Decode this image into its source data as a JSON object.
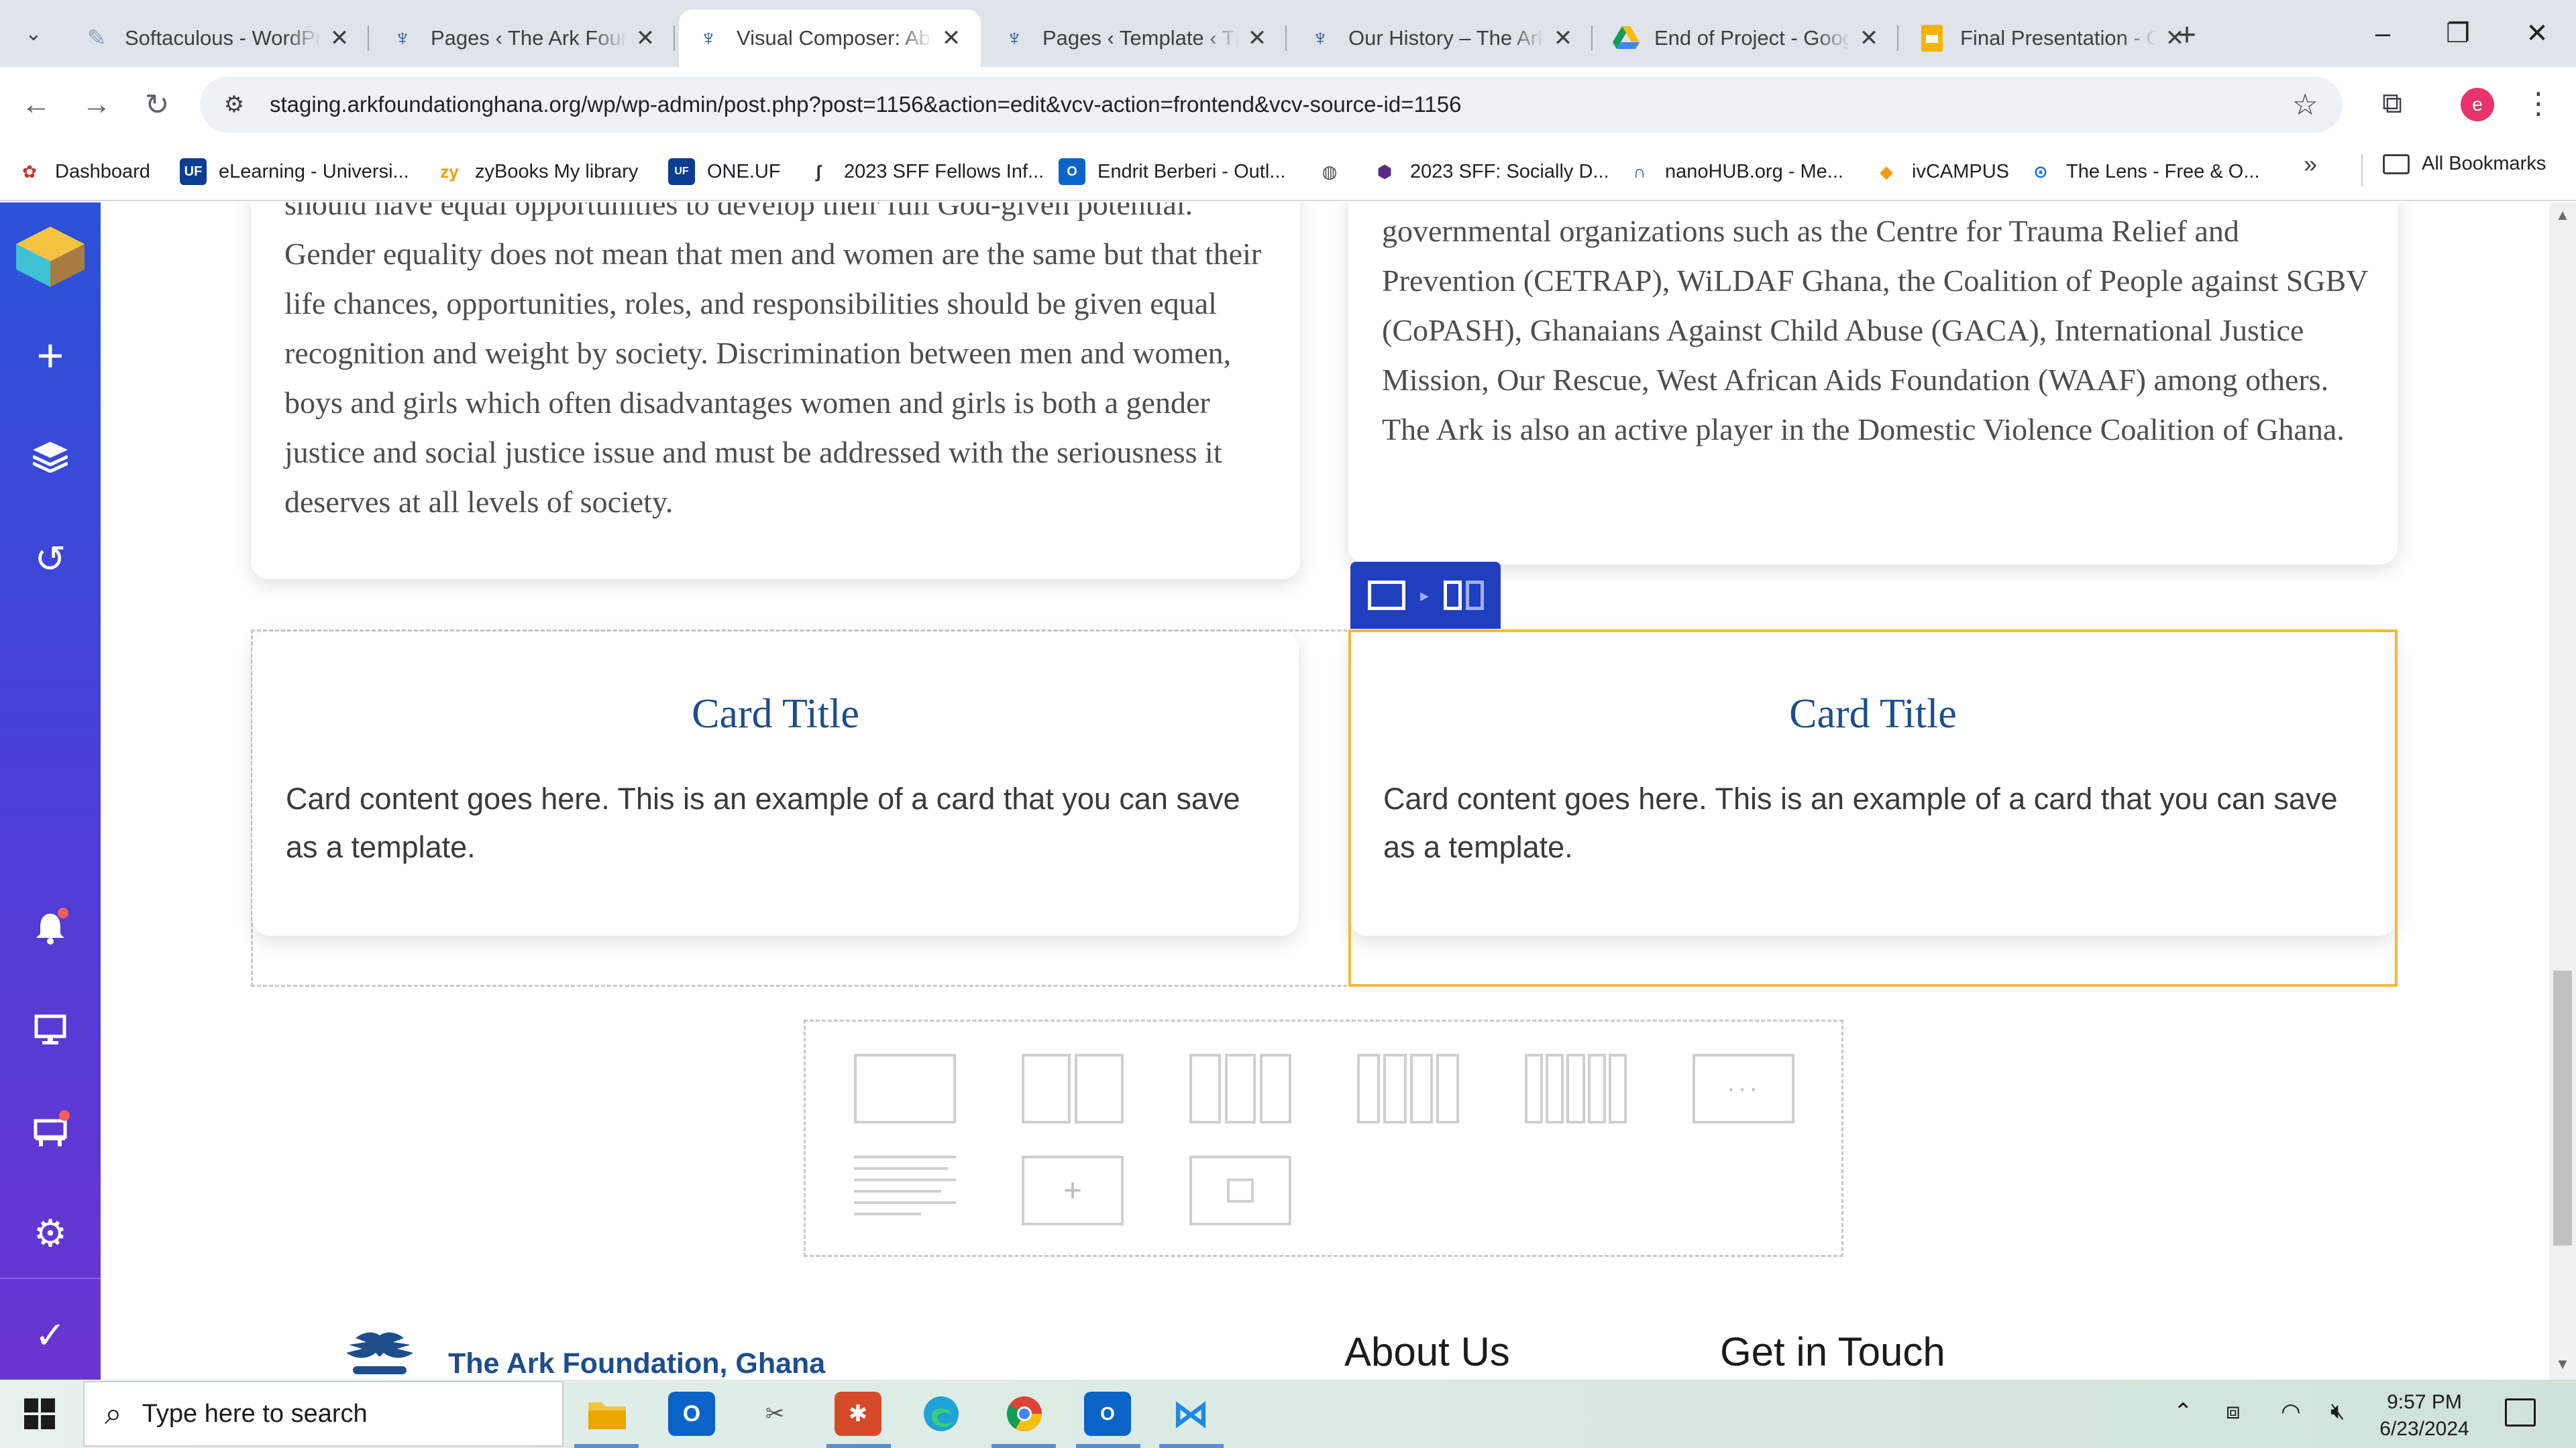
{
  "browser": {
    "tabs": [
      {
        "title": "Softaculous - WordPress",
        "favicon": "softaculous-icon",
        "active": false
      },
      {
        "title": "Pages ‹ The Ark Foundation",
        "favicon": "ark-bird-icon",
        "active": false
      },
      {
        "title": "Visual Composer: About",
        "favicon": "ark-bird-icon",
        "active": true
      },
      {
        "title": "Pages ‹ Template ‹ The Ark",
        "favicon": "ark-bird-icon",
        "active": false
      },
      {
        "title": "Our History – The Ark Foundation",
        "favicon": "ark-bird-icon",
        "active": false
      },
      {
        "title": "End of Project - Google Drive",
        "favicon": "google-drive-icon",
        "active": false
      },
      {
        "title": "Final Presentation - Google Slides",
        "favicon": "google-slides-icon",
        "active": false
      }
    ],
    "url": "staging.arkfoundationghana.org/wp/wp-admin/post.php?post=1156&action=edit&vcv-action=frontend&vcv-source-id=1156",
    "profile_initial": "e",
    "bookmarks": [
      {
        "label": "Dashboard",
        "icon": "wordpress-icon"
      },
      {
        "label": "eLearning - Universi...",
        "icon": "uf-icon"
      },
      {
        "label": "zyBooks My library",
        "icon": "zybooks-icon"
      },
      {
        "label": "ONE.UF",
        "icon": "oneuf-icon"
      },
      {
        "label": "2023 SFF Fellows Inf...",
        "icon": "doc-icon"
      },
      {
        "label": "Endrit Berberi - Outl...",
        "icon": "outlook-icon"
      },
      {
        "label": "",
        "icon": "globe-icon"
      },
      {
        "label": "2023 SFF: Socially D...",
        "icon": "sff-icon"
      },
      {
        "label": "nanoHUB.org - Me...",
        "icon": "nanohub-icon"
      },
      {
        "label": "ivCAMPUS",
        "icon": "ivcampus-icon"
      },
      {
        "label": "The Lens - Free & O...",
        "icon": "lens-icon"
      }
    ],
    "all_bookmarks": "All Bookmarks"
  },
  "content": {
    "left_text_partial_top": "should have equal opportunities to develop their full God-given potential.",
    "left_text": "Gender equality does not mean that men and women are the same but that their life chances, opportunities, roles, and responsibilities should be given equal recognition and weight by society. Discrimination between men and women, boys and girls which often disadvantages women and girls is both a gender justice and social justice issue and must be addressed with the seriousness it deserves at all levels of society.",
    "right_text": "governmental organizations such as the Centre for Trauma Relief and Prevention (CETRAP), WiLDAF Ghana, the Coalition of People against SGBV (CoPASH), Ghanaians Against Child Abuse (GACA), International Justice Mission, Our Rescue, West African Aids Foundation (WAAF) among others. The Ark is also an active player in the Domestic Violence Coalition of Ghana.",
    "cards": [
      {
        "title": "Card Title",
        "body": "Card content goes here. This is an example of a card that you can save as a template."
      },
      {
        "title": "Card Title",
        "body": "Card content goes here. This is an example of a card that you can save as a template."
      }
    ]
  },
  "footer": {
    "brand": "The Ark Foundation, Ghana",
    "about_heading": "About Us",
    "contact_heading": "Get in Touch"
  },
  "taskbar": {
    "search_placeholder": "Type here to search",
    "time": "9:57 PM",
    "date": "6/23/2024"
  },
  "colors": {
    "vc_sidebar_top": "#2b52d9",
    "vc_sidebar_bottom": "#6a34d0",
    "selection_outline": "#f3b83a",
    "card_title": "#1e4d8c",
    "column_toolbar": "#1f3fbf"
  }
}
